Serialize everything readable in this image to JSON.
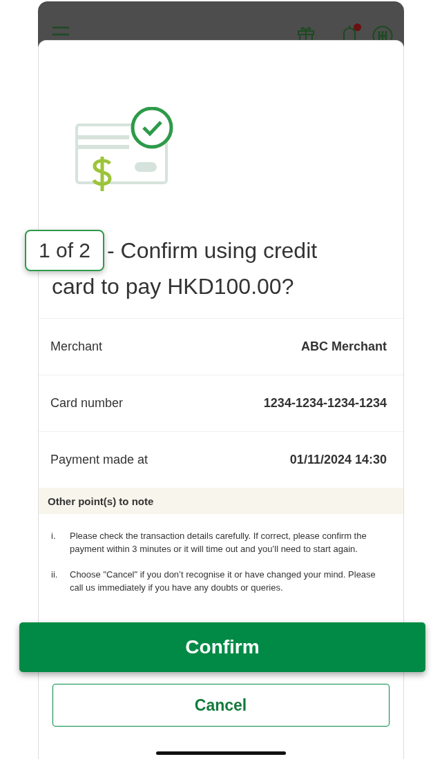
{
  "top_bar": {
    "has_notification": true
  },
  "step_badge": "1 of 2",
  "title_lines": [
    "- Confirm using credit",
    "card to pay HKD100.00?"
  ],
  "details": [
    {
      "label": "Merchant",
      "value": "ABC Merchant"
    },
    {
      "label": "Card number",
      "value": "1234-1234-1234-1234"
    },
    {
      "label": "Payment made at",
      "value": "01/11/2024  14:30"
    }
  ],
  "notes": {
    "heading": "Other point(s) to note",
    "items": [
      {
        "marker": "i.",
        "text": "Please check the transaction details carefully. If correct, please confirm the payment within 3 minutes or it will time out and you’ll need to start again."
      },
      {
        "marker": "ii.",
        "text": "Choose \"Cancel\" if you don’t recognise it or have changed your mind. Please call us immediately if you have any doubts or queries."
      }
    ]
  },
  "buttons": {
    "confirm": "Confirm",
    "cancel": "Cancel"
  }
}
